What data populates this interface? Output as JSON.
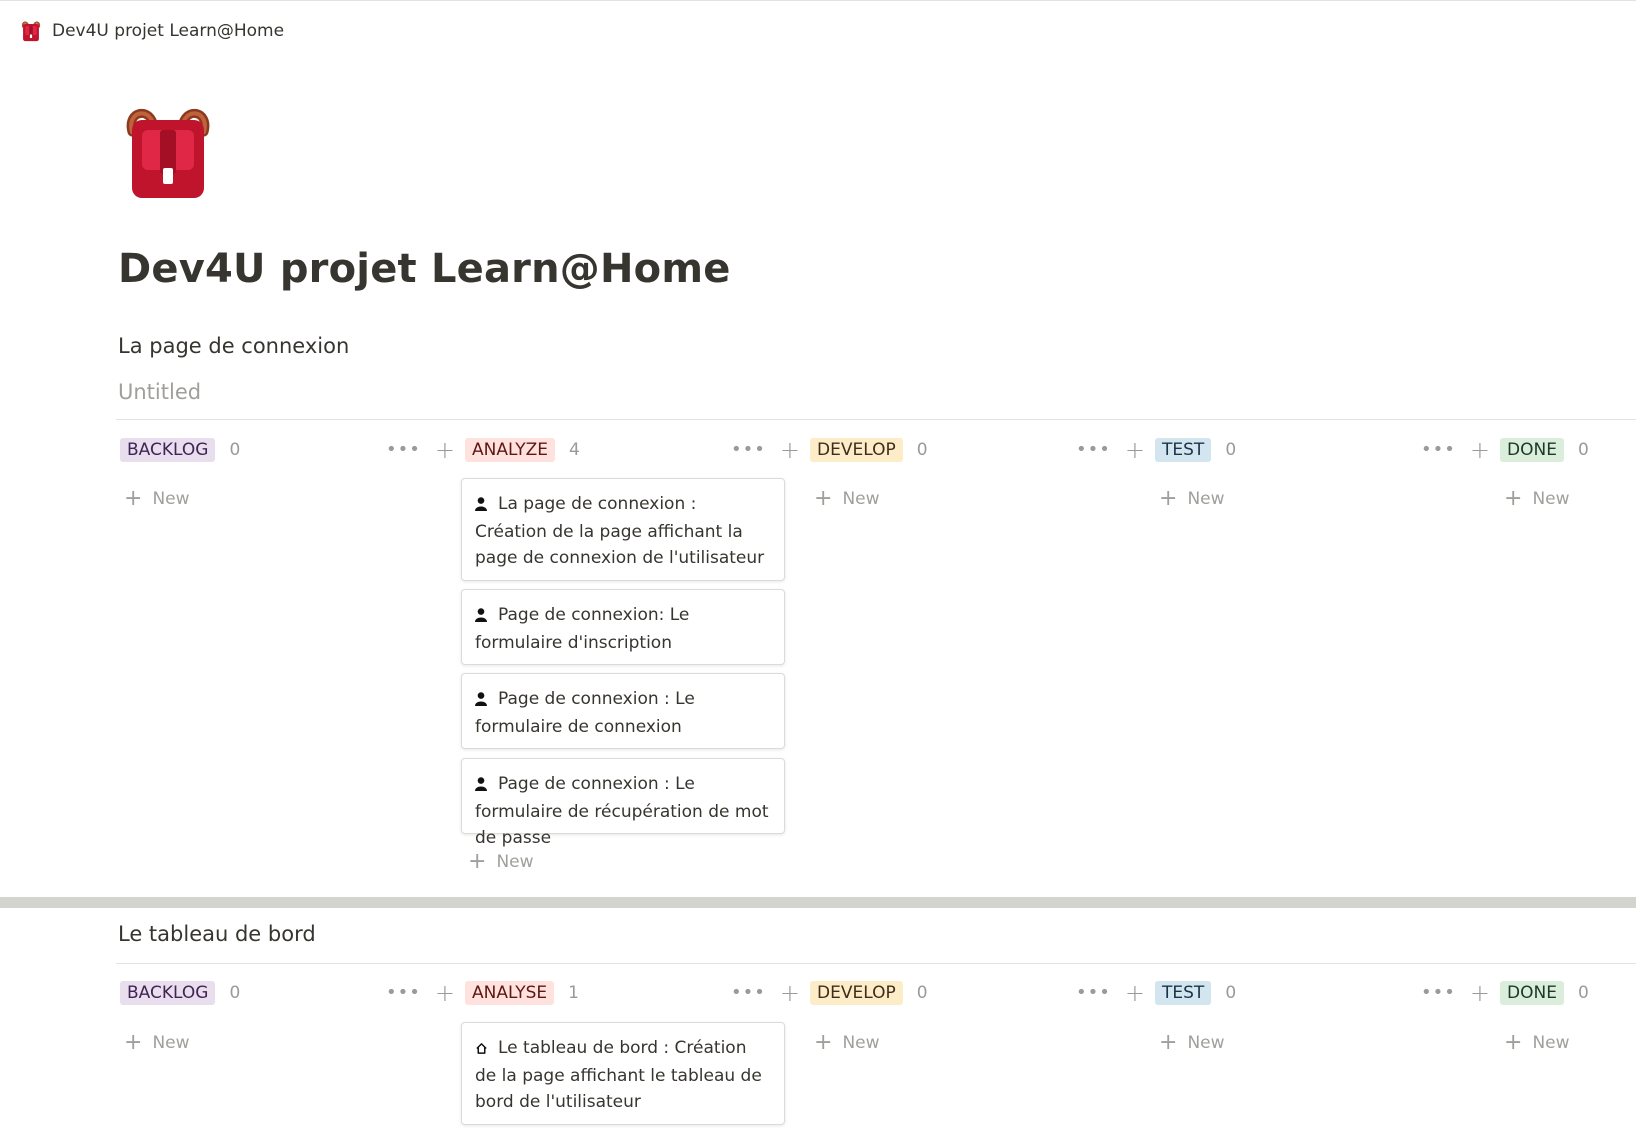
{
  "breadcrumb": {
    "icon": "backpack-icon",
    "label": "Dev4U projet Learn@Home"
  },
  "page": {
    "icon": "backpack-icon",
    "title": "Dev4U projet Learn@Home"
  },
  "colors": {
    "purple_tag": "#e8deee",
    "red_tag": "#ffe2dd",
    "yellow_tag": "#fdecc8",
    "blue_tag": "#d3e5ef",
    "green_tag": "#dbeddb",
    "text": "#37352f",
    "muted": "#a09f9b"
  },
  "boards": [
    {
      "title": "La page de connexion",
      "view_name": "Untitled",
      "columns": [
        {
          "tag": "BACKLOG",
          "count": "0",
          "new_label": "New"
        },
        {
          "tag": "ANALYZE",
          "count": "4",
          "new_label": "New",
          "cards": [
            {
              "icon": "person-icon",
              "text": "La page de connexion : Création de la page affichant la page de connexion de l'utilisateur"
            },
            {
              "icon": "person-icon",
              "text": "Page de connexion: Le formulaire d'inscription"
            },
            {
              "icon": "person-icon",
              "text": "Page de connexion : Le formulaire de connexion"
            },
            {
              "icon": "person-icon",
              "text": "Page de connexion : Le formulaire de récupération de mot de passe"
            }
          ]
        },
        {
          "tag": "DEVELOP",
          "count": "0",
          "new_label": "New"
        },
        {
          "tag": "TEST",
          "count": "0",
          "new_label": "New"
        },
        {
          "tag": "DONE",
          "count": "0",
          "new_label": "New"
        }
      ]
    },
    {
      "title": "Le tableau de bord",
      "columns": [
        {
          "tag": "BACKLOG",
          "count": "0",
          "new_label": "New"
        },
        {
          "tag": "ANALYSE",
          "count": "1",
          "cards": [
            {
              "icon": "home-icon",
              "text": "Le tableau de bord : Création de la page affichant le tableau de bord de l'utilisateur"
            }
          ]
        },
        {
          "tag": "DEVELOP",
          "count": "0",
          "new_label": "New"
        },
        {
          "tag": "TEST",
          "count": "0",
          "new_label": "New"
        },
        {
          "tag": "DONE",
          "count": "0",
          "new_label": "New"
        }
      ]
    }
  ]
}
